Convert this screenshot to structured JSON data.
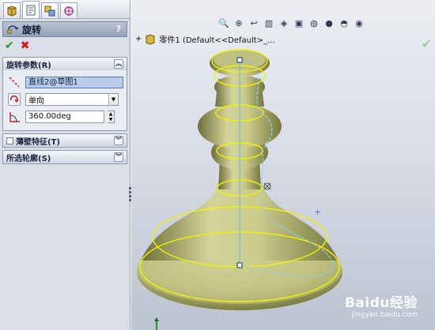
{
  "property_manager": {
    "tabs": [
      {
        "icon": "feature-manager-icon"
      },
      {
        "icon": "property-manager-icon"
      },
      {
        "icon": "configuration-manager-icon"
      },
      {
        "icon": "dimxpert-icon"
      }
    ],
    "title": "旋转",
    "help": "?",
    "revolve_params": {
      "header": "旋转参数(R)",
      "axis_value": "直线2@草图1",
      "direction_value": "单向",
      "angle_value": "360.00deg"
    },
    "thin_feature": {
      "header": "薄壁特征(T)"
    },
    "selected_contours": {
      "header": "所选轮廓(S)"
    }
  },
  "viewport": {
    "tree_label": "零件1 (Default<<Default>_...",
    "confirm_icon": "check-icon",
    "hud_icons": [
      "zoom-fit-icon",
      "zoom-area-icon",
      "previous-view-icon",
      "section-view-icon",
      "view-orientation-icon",
      "display-style-icon",
      "hide-show-icon",
      "edit-appearance-icon",
      "scene-icon",
      "lights-icon"
    ],
    "watermark": {
      "brand": "Baidu经验",
      "url": "jingyan.baidu.com"
    }
  },
  "colors": {
    "model_fill": "#c7c98a",
    "edge_yellow": "#f2f200",
    "axis_blue": "#6fb6e8",
    "panel_bg": "#d9dee8"
  }
}
